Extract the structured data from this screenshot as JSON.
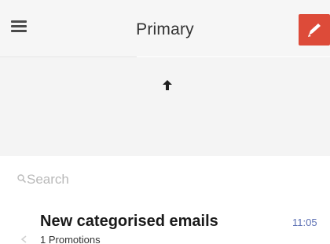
{
  "header": {
    "title": "Primary",
    "menu_icon": "hamburger-menu-icon",
    "compose_icon": "pencil-icon",
    "compose_color": "#dd4b39"
  },
  "pull_to_refresh": {
    "icon": "arrow-up-icon"
  },
  "search": {
    "placeholder": "Search",
    "icon": "search-icon"
  },
  "emails": [
    {
      "sender": "New categorised emails",
      "time": "11:05",
      "subline": "1 Promotions"
    }
  ]
}
